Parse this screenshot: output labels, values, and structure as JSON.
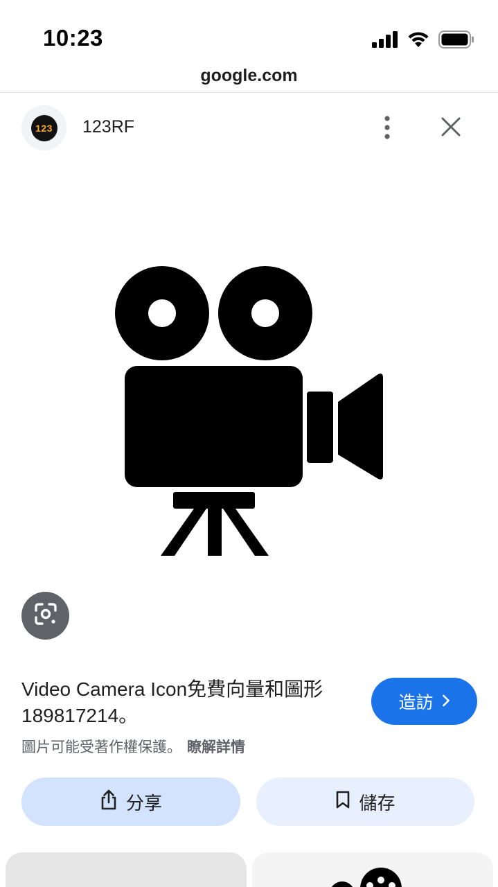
{
  "status_bar": {
    "time": "10:23"
  },
  "url_bar": {
    "domain": "google.com"
  },
  "source": {
    "logo_text": "123",
    "name": "123RF"
  },
  "image": {
    "subject_icon": "video-camera-icon"
  },
  "result": {
    "title": "Video Camera Icon免費向量和圖形189817214。",
    "visit_label": "造訪",
    "copyright_notice": "圖片可能受著作權保護。",
    "learn_more_label": "瞭解詳情"
  },
  "actions": {
    "share_label": "分享",
    "save_label": "儲存"
  },
  "colors": {
    "accent": "#1a73e8",
    "share_bg": "#d3e3fd",
    "save_bg": "#e8f0fe",
    "logo_text": "#f5a623"
  },
  "icons": [
    "signal-icon",
    "wifi-icon",
    "battery-icon",
    "more-vertical-icon",
    "close-icon",
    "google-lens-icon",
    "chevron-right-icon",
    "share-icon",
    "bookmark-icon"
  ]
}
